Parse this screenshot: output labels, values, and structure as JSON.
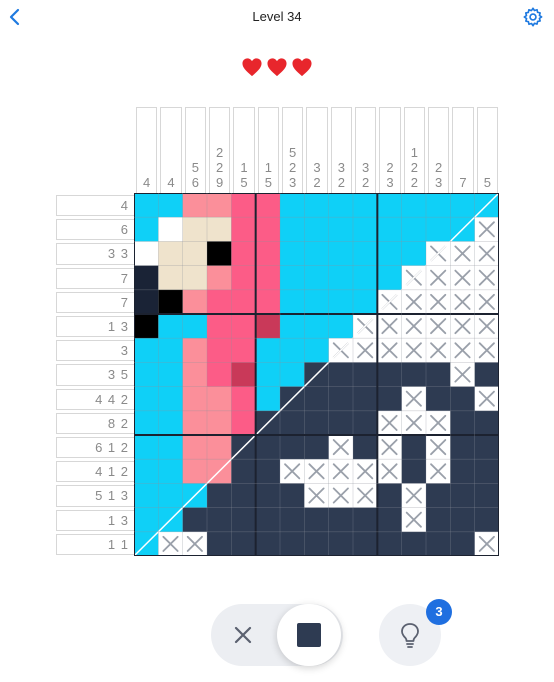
{
  "header": {
    "title": "Level 34"
  },
  "lives": {
    "count": 3,
    "color": "#e8262c"
  },
  "puzzle": {
    "size": 15,
    "column_clues": [
      [
        "4"
      ],
      [
        "4"
      ],
      [
        "5",
        "6"
      ],
      [
        "2",
        "2",
        "9"
      ],
      [
        "1",
        "5"
      ],
      [
        "1",
        "5"
      ],
      [
        "5",
        "2",
        "3"
      ],
      [
        "3",
        "2"
      ],
      [
        "3",
        "2"
      ],
      [
        "3",
        "2"
      ],
      [
        "2",
        "3"
      ],
      [
        "1",
        "2",
        "2"
      ],
      [
        "2",
        "3"
      ],
      [
        "7"
      ],
      [
        "5"
      ]
    ],
    "row_clues": [
      "4",
      "6",
      "3 3",
      "7",
      "7",
      "1 3",
      "3",
      "3 5",
      "4 4 2",
      "8 2",
      "6 1 2",
      "4 1 2",
      "5 1 3",
      "1 3",
      "1 1"
    ],
    "palette": {
      "B": "#0fd0f7",
      "p": "#fb8f9a",
      "P": "#fc5c87",
      "c": "#efe3cc",
      "k": "#000000",
      "d": "#1a2336",
      "w": "#ffffff",
      "r": "#c93959",
      "N": "#2e3b52",
      "X": "#ffffff"
    },
    "grid": [
      "BBppPPBBBBBBBBB",
      "BwccPPBBBBBBBBX",
      "wcckPPBBBBBBXXX",
      "dccpPPBBBBBXXXX",
      "dkpPPPBBBBXXXXX",
      "kBBPPrBBBXXXXXX",
      "BBpPPBBBXXXXXXX",
      "BBpPrBBNNNNNNXN",
      "BBppPBNNNNNXNNX",
      "BBppPNNNNNXXXNN",
      "BBppNNNNXNXNXNN",
      "BBppNNXXXXXNXNN",
      "BBBNNNNXXXNXNNN",
      "BBNNNNNNNNNXNNN",
      "BXXNNNNNNNNNNNX"
    ],
    "split_color_light": "#ffffff",
    "marker_color": "#9aa0aa",
    "navy": "#2e3b52",
    "grid_line_color": "#8d939c"
  },
  "controls": {
    "mode_cross_icon": "cross-icon",
    "mode_fill_icon": "fill-square-icon",
    "active_mode": "fill",
    "hint_icon": "lightbulb-icon",
    "hint_count": "3"
  }
}
